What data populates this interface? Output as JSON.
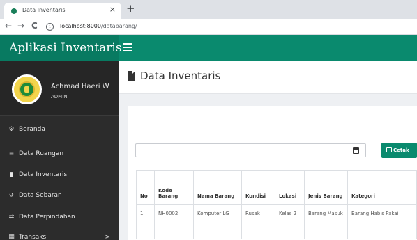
{
  "browser": {
    "tab_title": "Data Inventaris",
    "close_glyph": "×",
    "new_tab_glyph": "+",
    "back_glyph": "←",
    "forward_glyph": "→",
    "reload_glyph": "C",
    "url_host": "localhost:8000",
    "url_path": "/databarang/"
  },
  "app": {
    "brand": "Aplikasi Inventaris",
    "colors": {
      "primary": "#0a8a6e",
      "sidebar": "#2c2c2c"
    }
  },
  "user": {
    "name": "Achmad Haeri W",
    "role": "ADMIN"
  },
  "sidebar": {
    "items": [
      {
        "label": "Beranda",
        "icon": "dashboard-icon",
        "glyph": "⚙"
      },
      {
        "label": "Data Ruangan",
        "icon": "list-icon",
        "glyph": "≡"
      },
      {
        "label": "Data Inventaris",
        "icon": "file-icon",
        "glyph": "▮"
      },
      {
        "label": "Data Sebaran",
        "icon": "history-icon",
        "glyph": "↺"
      },
      {
        "label": "Data Perpindahan",
        "icon": "exchange-icon",
        "glyph": "⇄"
      },
      {
        "label": "Transaksi",
        "icon": "table-icon",
        "glyph": "▦",
        "chevron": ">"
      }
    ]
  },
  "page": {
    "title": "Data Inventaris",
    "date_placeholder": "--------- ----",
    "print_label": "Cetak"
  },
  "table": {
    "headers": [
      "No",
      "Kode Barang",
      "Nama Barang",
      "Kondisi",
      "Lokasi",
      "Jenis Barang",
      "Kategori"
    ],
    "rows": [
      [
        "1",
        "NH0002",
        "Komputer LG",
        "Rusak",
        "Kelas 2",
        "Barang Masuk",
        "Barang Habis Pakai"
      ]
    ]
  }
}
